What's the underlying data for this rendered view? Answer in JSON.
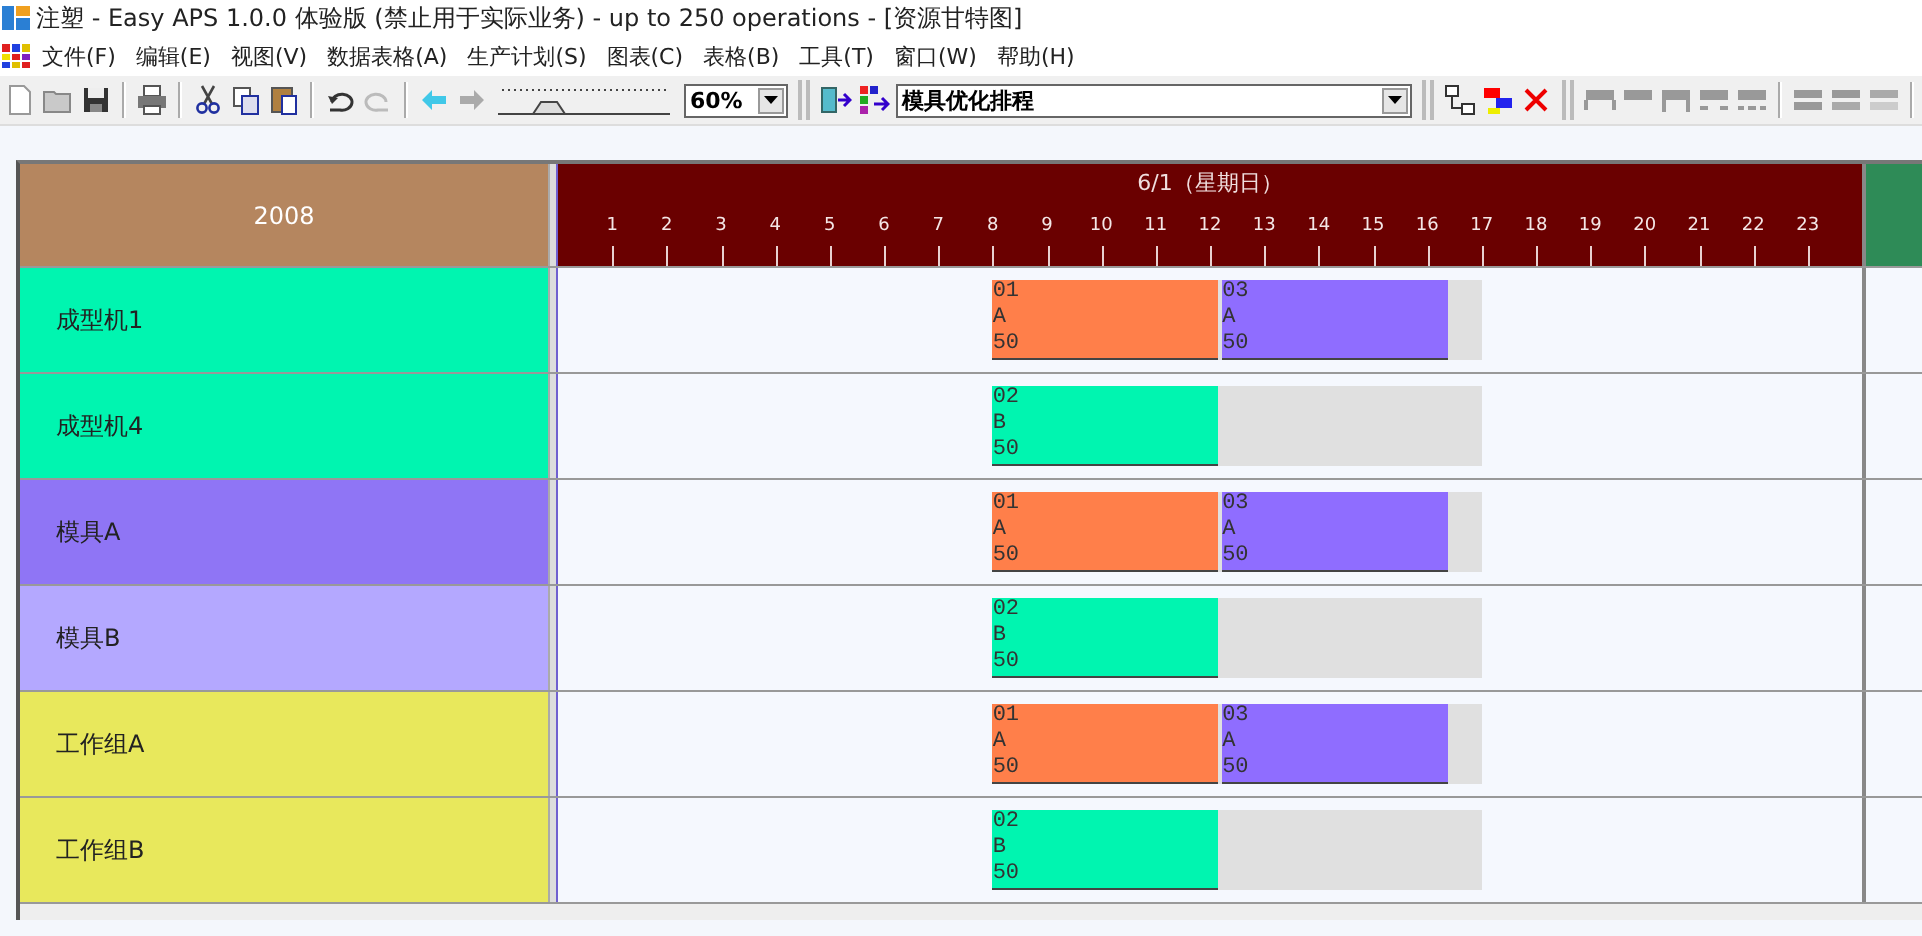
{
  "window": {
    "title": "注塑 - Easy APS 1.0.0 体验版 (禁止用于实际业务) - up to 250 operations - [资源甘特图]"
  },
  "menu": [
    "文件(F)",
    "编辑(E)",
    "视图(V)",
    "数据表格(A)",
    "生产计划(S)",
    "图表(C)",
    "表格(B)",
    "工具(T)",
    "窗口(W)",
    "帮助(H)"
  ],
  "toolbar": {
    "zoom_slider": {
      "level": 0.25
    },
    "zoom": {
      "value": "60%"
    },
    "schedule": {
      "value": "模具优化排程"
    }
  },
  "gantt": {
    "year": "2008",
    "date": "6/1（星期日）",
    "hours": [
      "1",
      "2",
      "3",
      "4",
      "5",
      "6",
      "7",
      "8",
      "9",
      "10",
      "11",
      "12",
      "13",
      "14",
      "15",
      "16",
      "17",
      "18",
      "19",
      "20",
      "21",
      "22",
      "23"
    ],
    "rows": [
      {
        "label": "成型机1",
        "color": "#00f5b0",
        "tasks": [
          {
            "order": "01",
            "product": "A",
            "quantity": "50",
            "color": "#ff7f4a"
          },
          {
            "order": "03",
            "product": "A",
            "quantity": "50",
            "color": "#8f6dff"
          }
        ]
      },
      {
        "label": "成型机4",
        "color": "#00f5b0",
        "tasks": [
          {
            "order": "02",
            "product": "B",
            "quantity": "50",
            "color": "#00f5b0"
          }
        ]
      },
      {
        "label": "模具A",
        "color": "#8f75f5",
        "tasks": [
          {
            "order": "01",
            "product": "A",
            "quantity": "50",
            "color": "#ff7f4a"
          },
          {
            "order": "03",
            "product": "A",
            "quantity": "50",
            "color": "#8f6dff"
          }
        ]
      },
      {
        "label": "模具B",
        "color": "#b4a8ff",
        "tasks": [
          {
            "order": "02",
            "product": "B",
            "quantity": "50",
            "color": "#00f5b0"
          }
        ]
      },
      {
        "label": "工作组A",
        "color": "#e8e85c",
        "tasks": [
          {
            "order": "01",
            "product": "A",
            "quantity": "50",
            "color": "#ff7f4a"
          },
          {
            "order": "03",
            "product": "A",
            "quantity": "50",
            "color": "#8f6dff"
          }
        ]
      },
      {
        "label": "工作组B",
        "color": "#e8e85c",
        "tasks": [
          {
            "order": "02",
            "product": "B",
            "quantity": "50",
            "color": "#00f5b0"
          }
        ]
      }
    ]
  }
}
